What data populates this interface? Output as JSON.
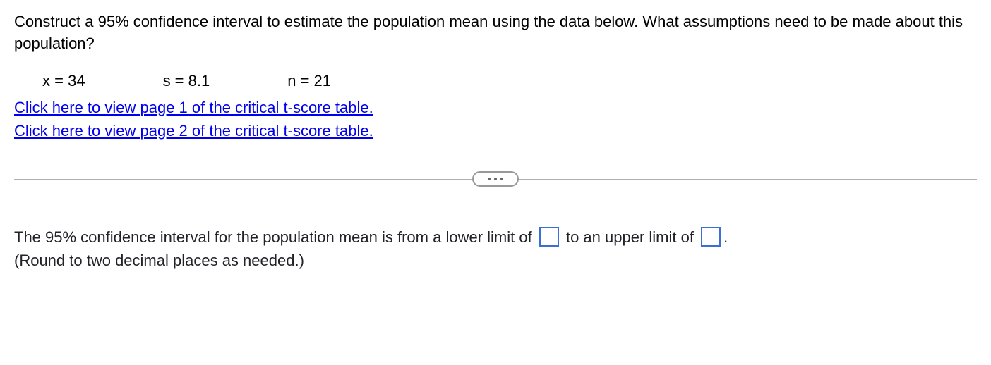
{
  "question": {
    "prompt": "Construct a 95% confidence interval to estimate the population mean using the data below. What assumptions need to be made about this population?",
    "data": {
      "xbar_label": "x",
      "xbar_value": "= 34",
      "s": "s = 8.1",
      "n": "n = 21"
    },
    "links": {
      "page1": "Click here to view page 1 of the critical t-score table.",
      "page2": "Click here to view page 2 of the critical t-score table."
    }
  },
  "answer": {
    "prefix": "The 95% confidence interval for the population mean is from a lower limit of",
    "middle": " to an upper limit of",
    "suffix": ".",
    "round_note": "(Round to two decimal places as needed.)"
  }
}
